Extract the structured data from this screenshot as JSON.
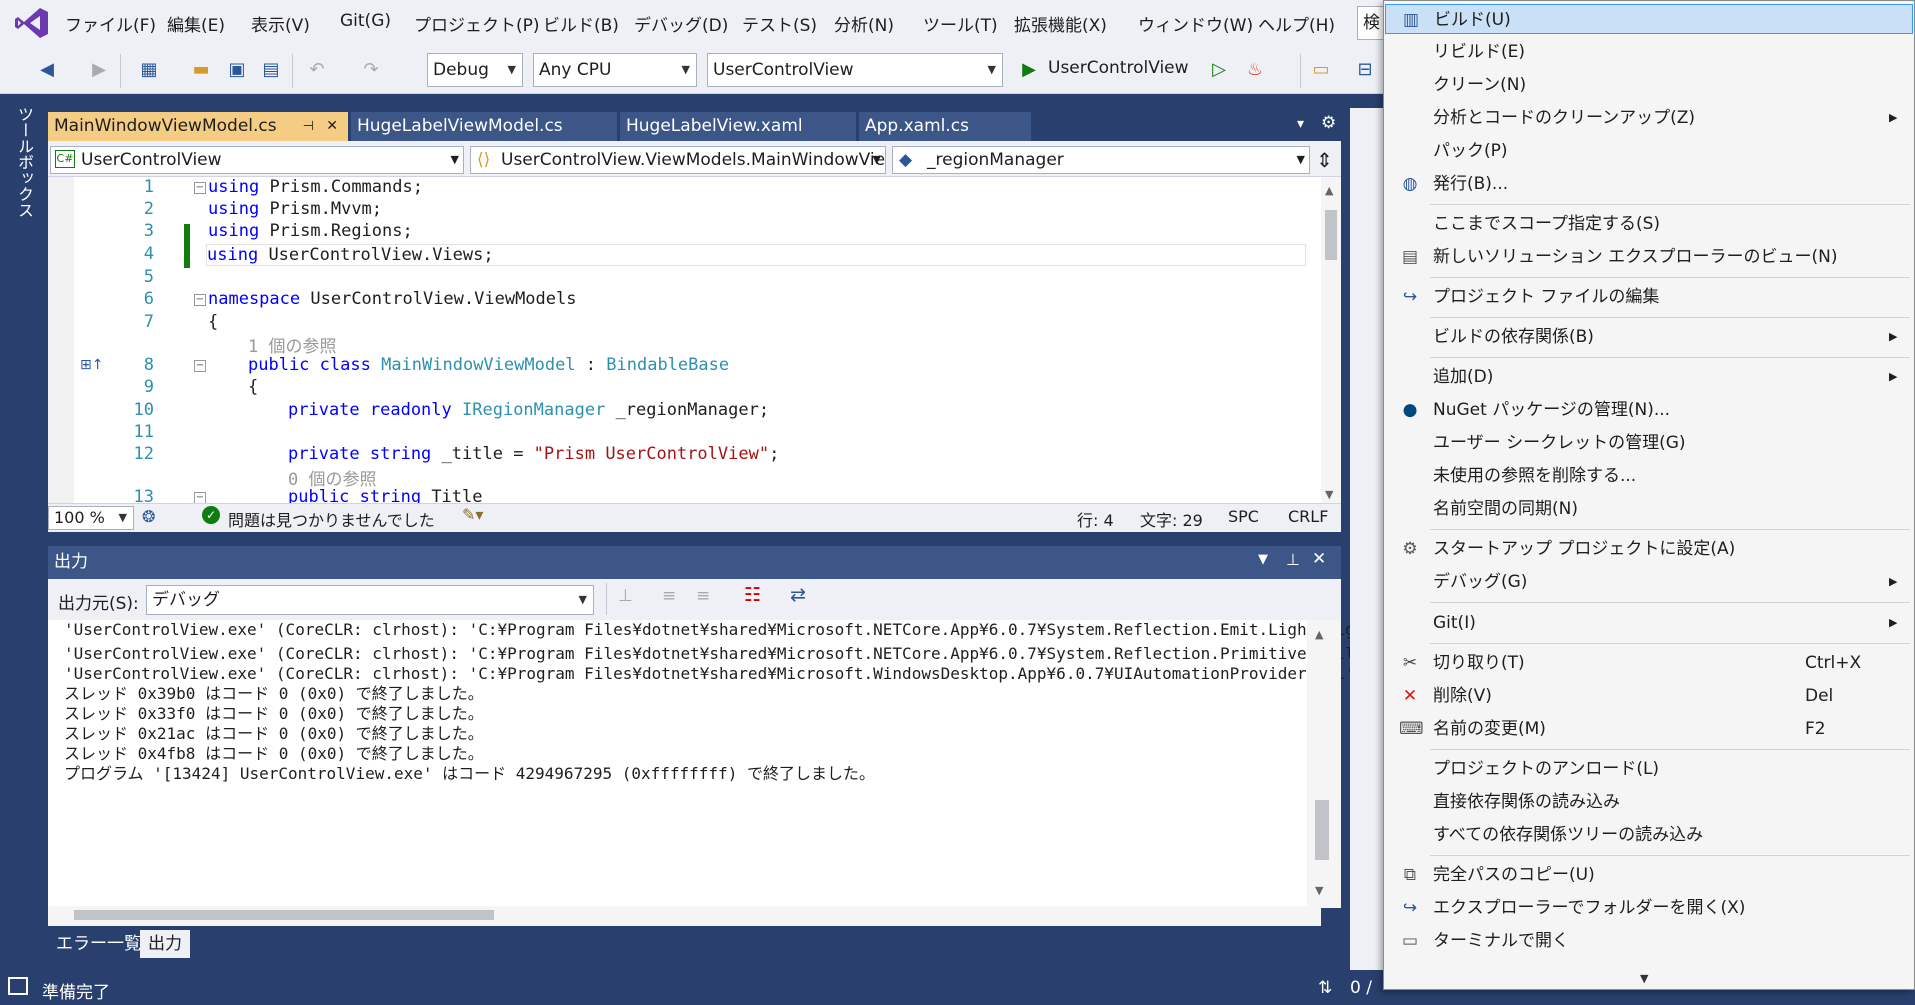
{
  "menubar": {
    "items": [
      "ファイル(F)",
      "編集(E)",
      "表示(V)",
      "Git(G)",
      "プロジェクト(P)",
      "ビルド(B)",
      "デバッグ(D)",
      "テスト(S)",
      "分析(N)",
      "ツール(T)",
      "拡張機能(X)",
      "ウィンドウ(W)",
      "ヘルプ(H)"
    ],
    "search_stub": "検"
  },
  "toolbar": {
    "config": "Debug",
    "platform": "Any CPU",
    "startup": "UserControlView",
    "run_label": "UserControlView"
  },
  "toolbox": {
    "label": "ツールボックス"
  },
  "tabs": [
    "MainWindowViewModel.cs",
    "HugeLabelViewModel.cs",
    "HugeLabelView.xaml",
    "App.xaml.cs"
  ],
  "navbar": {
    "project": "UserControlView",
    "type": "UserControlView.ViewModels.MainWindowVie",
    "member": "_regionManager"
  },
  "code": {
    "line_numbers": [
      "1",
      "2",
      "3",
      "4",
      "5",
      "6",
      "7",
      "8",
      "9",
      "10",
      "11",
      "12",
      "13"
    ],
    "using": "using",
    "ns1": "Prism.Commands;",
    "ns2": "Prism.Mvvm;",
    "ns3": "Prism.Regions;",
    "ns4": "UserControlView.Views;",
    "namespace_kw": "namespace",
    "namespace_name": "UserControlView.ViewModels",
    "brace_open": "{",
    "ref1": "1 個の参照",
    "public_class": "public class",
    "class_name": "MainWindowViewModel",
    " colon": ":",
    "base": "BindableBase",
    "priv_ro": "private readonly",
    "iface": "IRegionManager",
    "field": "_regionManager;",
    "priv_str": "private string",
    "title_field": "_title = ",
    "title_val": "\"Prism UserControlView\"",
    "semi": ";",
    "ref0": "0 個の参照",
    "pub_str": "public string",
    "prop": "Title"
  },
  "editor_status": {
    "zoom": "100 %",
    "issues": "問題は見つかりませんでした",
    "line": "行: 4",
    "col": "文字: 29",
    "spc": "SPC",
    "eol": "CRLF"
  },
  "output": {
    "title": "出力",
    "source_label": "出力元(S):",
    "source_value": "デバッグ",
    "lines": [
      "'UserControlView.exe' (CoreCLR: clrhost): 'C:¥Program Files¥dotnet¥shared¥Microsoft.NETCore.App¥6.0.7¥System.Reflection.Emit.Lightweight.d",
      "'UserControlView.exe' (CoreCLR: clrhost): 'C:¥Program Files¥dotnet¥shared¥Microsoft.NETCore.App¥6.0.7¥System.Reflection.Primitives.dll' が読",
      "'UserControlView.exe' (CoreCLR: clrhost): 'C:¥Program Files¥dotnet¥shared¥Microsoft.WindowsDesktop.App¥6.0.7¥UIAutomationProvider.dll' が読",
      "スレッド 0x39b0 はコード 0 (0x0) で終了しました。",
      "スレッド 0x33f0 はコード 0 (0x0) で終了しました。",
      "スレッド 0x21ac はコード 0 (0x0) で終了しました。",
      "スレッド 0x4fb8 はコード 0 (0x0) で終了しました。",
      "プログラム '[13424] UserControlView.exe' はコード 4294967295 (0xffffffff) で終了しました。"
    ]
  },
  "bottom_tabs": [
    "エラー一覧",
    "出力"
  ],
  "statusbar": {
    "ready": "準備完了",
    "right": "0 /"
  },
  "context_menu": {
    "build": "ビルド(U)",
    "rebuild": "リビルド(E)",
    "clean": "クリーン(N)",
    "analyze": "分析とコードのクリーンアップ(Z)",
    "pack": "パック(P)",
    "publish": "発行(B)...",
    "scope": "ここまでスコープ指定する(S)",
    "new_view": "新しいソリューション エクスプローラーのビュー(N)",
    "edit_proj": "プロジェクト ファイルの編集",
    "build_deps": "ビルドの依存関係(B)",
    "add": "追加(D)",
    "nuget": "NuGet パッケージの管理(N)...",
    "secrets": "ユーザー シークレットの管理(G)",
    "remove_refs": "未使用の参照を削除する...",
    "sync_ns": "名前空間の同期(N)",
    "startup": "スタートアップ プロジェクトに設定(A)",
    "debug": "デバッグ(G)",
    "git": "Git(I)",
    "cut": "切り取り(T)",
    "cut_key": "Ctrl+X",
    "delete": "削除(V)",
    "delete_key": "Del",
    "rename": "名前の変更(M)",
    "rename_key": "F2",
    "unload": "プロジェクトのアンロード(L)",
    "load_direct": "直接依存関係の読み込み",
    "load_all": "すべての依存関係ツリーの読み込み",
    "copy_path": "完全パスのコピー(U)",
    "open_explorer": "エクスプローラーでフォルダーを開く(X)",
    "open_terminal": "ターミナルで開く"
  },
  "colors": {
    "accent": "#29406e",
    "tab_active": "#f5cc84",
    "highlight": "#c9e0f7",
    "keyword": "#0000ff",
    "type": "#2b91af"
  }
}
